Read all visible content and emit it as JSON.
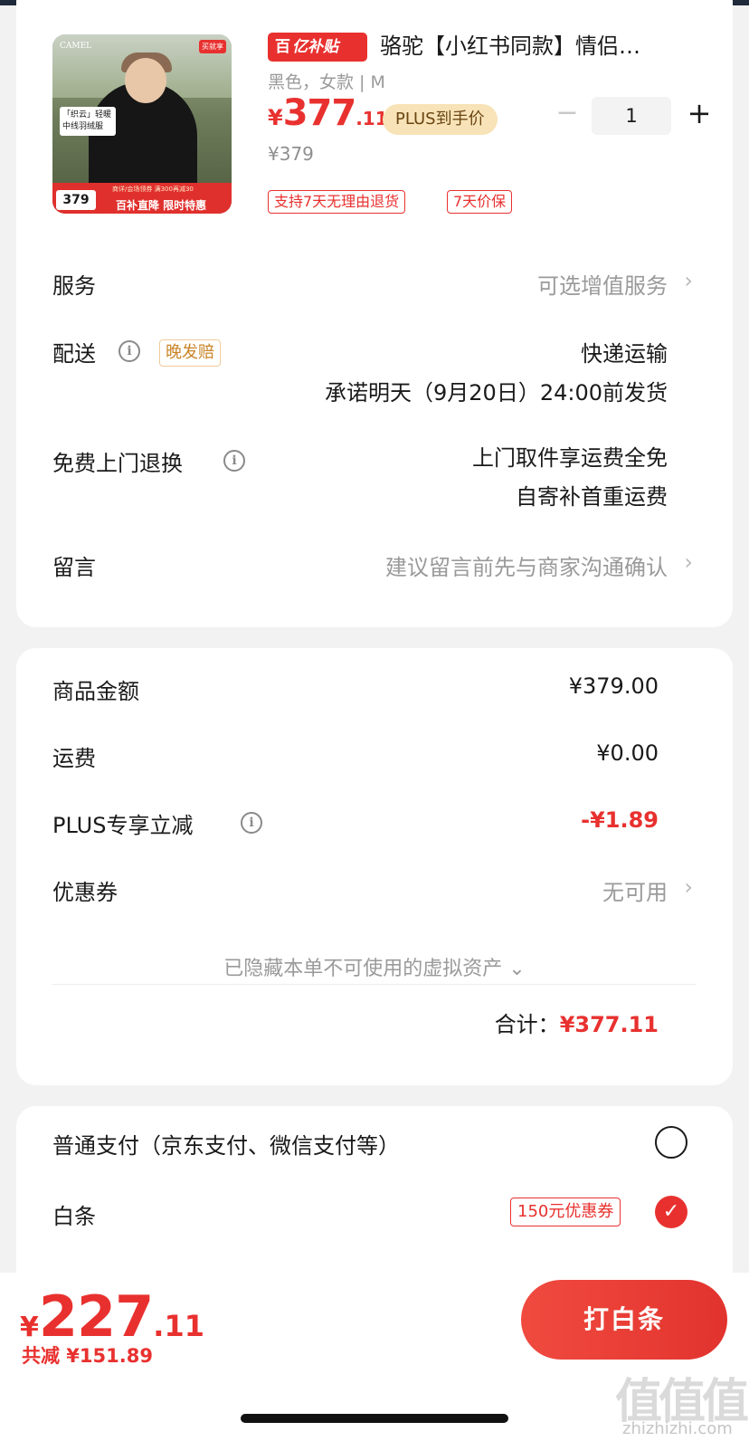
{
  "product": {
    "thumb": {
      "brand": "CAMEL",
      "corner_badge": "买就享",
      "promo_text": "「织云」轻暖 中线羽绒服",
      "ribbon_small": "商详/会场领券 满300再减30",
      "ribbon_text": "百补直降 限时特惠",
      "price": "379"
    },
    "subsidy_logo": "亿补贴",
    "title": "骆驼【小红书同款】情侣…",
    "spec": "黑色，女款 | M",
    "price_yen": "¥",
    "price_int": "377",
    "price_dec": ".11",
    "plus_tag": "PLUS到手价",
    "old_price": "¥379",
    "quantity": "1",
    "tags": [
      "支持7天无理由退货",
      "7天价保"
    ]
  },
  "rows": {
    "service_label": "服务",
    "service_value": "可选增值服务",
    "delivery_label": "配送",
    "delivery_tag": "晚发赔",
    "delivery_method": "快递运输",
    "delivery_promise": "承诺明天（9月20日）24:00前发货",
    "return_label": "免费上门退换",
    "return_line1": "上门取件享运费全免",
    "return_line2": "自寄补首重运费",
    "message_label": "留言",
    "message_placeholder": "建议留言前先与商家沟通确认"
  },
  "price_detail": {
    "goods_label": "商品金额",
    "goods_value": "¥379.00",
    "freight_label": "运费",
    "freight_value": "¥0.00",
    "plus_label": "PLUS专享立减",
    "plus_value": "-¥1.89",
    "coupon_label": "优惠券",
    "coupon_value": "无可用",
    "hidden_assets": "已隐藏本单不可使用的虚拟资产 ⌄",
    "total_label": "合计：",
    "total_value": "¥377.11"
  },
  "payment": {
    "normal_label": "普通支付（京东支付、微信支付等）",
    "baitiao_label": "白条",
    "baitiao_coupon": "150元优惠券"
  },
  "bottom": {
    "yen": "¥",
    "int": "227",
    "dec": ".11",
    "saved": "共减 ¥151.89",
    "pay_button": "打白条"
  },
  "watermark": {
    "text": "值值值",
    "url": "zhizhizhi.com"
  },
  "colors": {
    "accent": "#e8312f",
    "plus_bg": "#f7e3b7"
  }
}
